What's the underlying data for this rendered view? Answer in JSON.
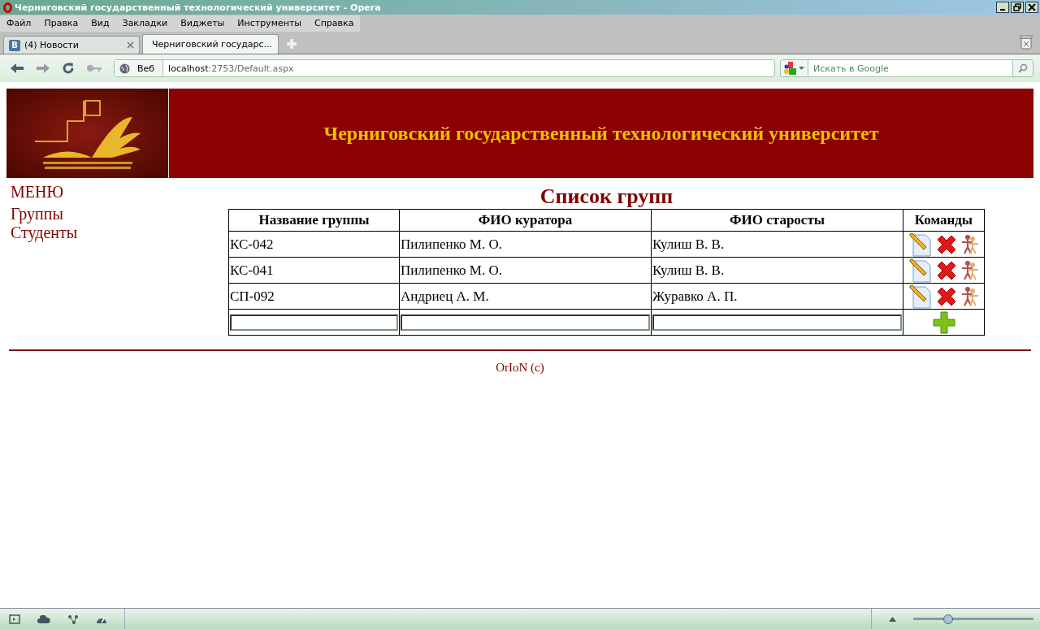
{
  "window": {
    "title": "Черниговский государственный технологический университет - Opera"
  },
  "menu_bar": [
    "Файл",
    "Правка",
    "Вид",
    "Закладки",
    "Виджеты",
    "Инструменты",
    "Справка"
  ],
  "tabs": [
    {
      "label": "(4) Новости",
      "badge": "В",
      "selected": false
    },
    {
      "label": "Черниговский государс...",
      "selected": true
    }
  ],
  "address_bar": {
    "scope": "Веб",
    "host": "localhost",
    "path": ":2753/Default.aspx"
  },
  "search": {
    "placeholder": "Искать в Google"
  },
  "header": {
    "title": "Черниговский государственный технологический университет"
  },
  "sidebar": {
    "heading": "МЕНЮ",
    "items": [
      "Группы",
      "Студенты"
    ]
  },
  "page_title": "Список групп",
  "table": {
    "columns": [
      "Название группы",
      "ФИО куратора",
      "ФИО старосты",
      "Команды"
    ],
    "rows": [
      [
        "КС-042",
        "Пилипенко М. О.",
        "Кулиш В. В."
      ],
      [
        "КС-041",
        "Пилипенко М. О.",
        "Кулиш В. В."
      ],
      [
        "СП-092",
        "Андриец А. М.",
        "Журавко А. П."
      ]
    ]
  },
  "footer": "OrIoN (c)",
  "status_bar": {
    "zoom": {
      "level": 0.29
    }
  }
}
